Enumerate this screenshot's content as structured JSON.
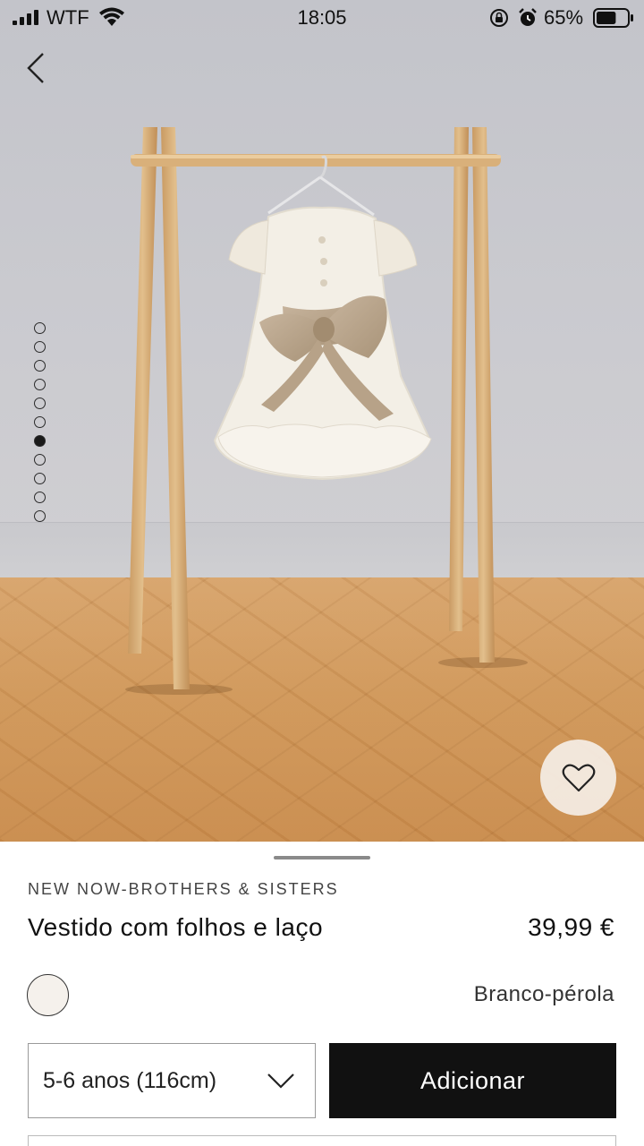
{
  "status_bar": {
    "carrier": "WTF",
    "time": "18:05",
    "battery_percent": "65%",
    "battery_level": 0.65
  },
  "navigation": {
    "back_icon": "chevron-left-icon"
  },
  "gallery": {
    "image_count": 11,
    "active_index": 6,
    "wishlist_icon": "heart-outline-icon"
  },
  "product": {
    "collection": "NEW NOW-BROTHERS & SISTERS",
    "name": "Vestido com folhos e laço",
    "price": "39,99 €",
    "color": {
      "name": "Branco-pérola",
      "swatch_hex": "#f5f1ec"
    },
    "size": {
      "selected": "5-6 anos (116cm)",
      "dropdown_icon": "chevron-down-icon"
    },
    "add_button_label": "Adicionar"
  },
  "theme": {
    "primary_button_bg": "#111111",
    "primary_button_text": "#ffffff"
  }
}
